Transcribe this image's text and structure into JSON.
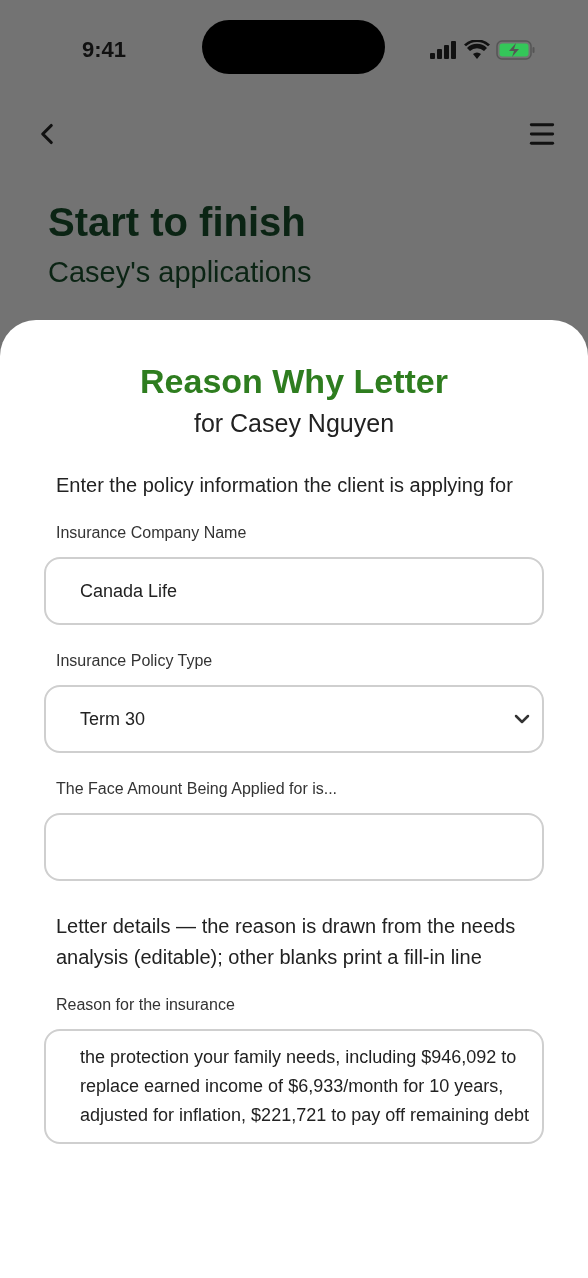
{
  "status_bar": {
    "time": "9:41"
  },
  "background": {
    "title": "Start to finish",
    "subtitle": "Casey's applications"
  },
  "sheet": {
    "title": "Reason Why Letter",
    "subtitle": "for Casey Nguyen",
    "sections": [
      {
        "intro": "Enter the policy information the client is applying for",
        "fields": [
          {
            "kind": "input",
            "label": "Insurance Company Name",
            "value": "Canada Life"
          },
          {
            "kind": "select",
            "label": "Insurance Policy Type",
            "value": "Term 30"
          },
          {
            "kind": "input",
            "label": "The Face Amount Being Applied for is..."
          }
        ]
      },
      {
        "intro": "Letter details — the reason is drawn from the needs analysis (editable); other blanks print a fill-in line",
        "fields": [
          {
            "kind": "textarea",
            "label": "Reason for the insurance",
            "value": "the protection your family needs, including $946,092 to replace earned income of $6,933/month for 10 years, adjusted for inflation, $221,721 to pay off remaining debt"
          }
        ]
      }
    ]
  }
}
